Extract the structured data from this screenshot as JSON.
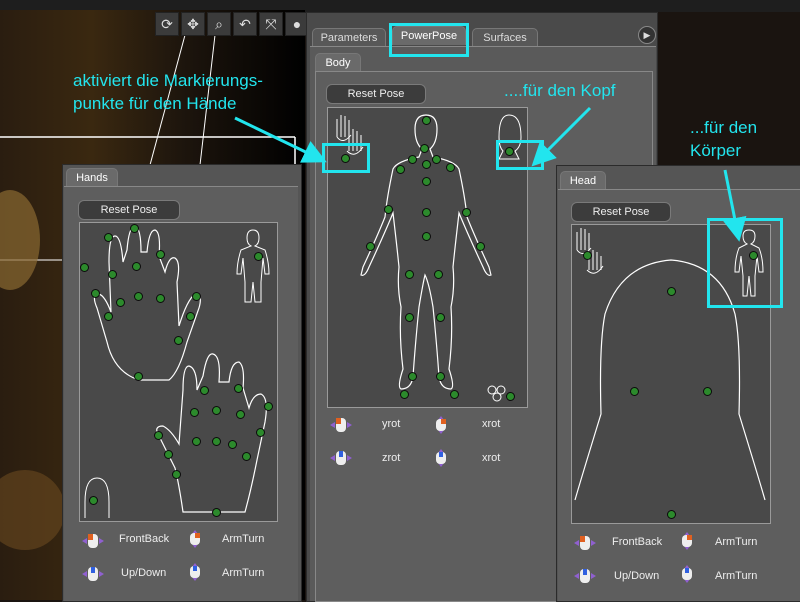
{
  "colors": {
    "accent": "#22e5ee",
    "dot": "#2c8a2c",
    "panel": "#5a5a5a"
  },
  "viewport": {
    "tools": [
      "rotate-icon",
      "move-icon",
      "zoom-icon",
      "undo-icon",
      "scale-icon",
      "orb-icon"
    ]
  },
  "main_panel": {
    "tabs": [
      "Parameters",
      "PowerPose",
      "Surfaces"
    ],
    "active_tab": "PowerPose",
    "subtab": "Body",
    "reset_label": "Reset Pose",
    "controls": [
      {
        "label": "yrot",
        "mouse": "left"
      },
      {
        "label": "xrot",
        "mouse": "right"
      },
      {
        "label": "zrot",
        "mouse": "middle"
      },
      {
        "label": "xrot",
        "mouse": "both"
      }
    ]
  },
  "hands_panel": {
    "subtab": "Hands",
    "reset_label": "Reset Pose",
    "controls": [
      {
        "label": "FrontBack",
        "mouse": "left"
      },
      {
        "label": "ArmTurn",
        "mouse": "right"
      },
      {
        "label": "Up/Down",
        "mouse": "middle"
      },
      {
        "label": "ArmTurn",
        "mouse": "both"
      }
    ]
  },
  "head_panel": {
    "subtab": "Head",
    "reset_label": "Reset Pose",
    "controls": [
      {
        "label": "FrontBack",
        "mouse": "left"
      },
      {
        "label": "ArmTurn",
        "mouse": "right"
      },
      {
        "label": "Up/Down",
        "mouse": "middle"
      },
      {
        "label": "ArmTurn",
        "mouse": "both"
      }
    ]
  },
  "annotations": {
    "hands_line1": "aktiviert die Markierungs-",
    "hands_line2": "punkte für den Hände",
    "head": "....für den Kopf",
    "body_line1": "...für den",
    "body_line2": "Körper"
  }
}
